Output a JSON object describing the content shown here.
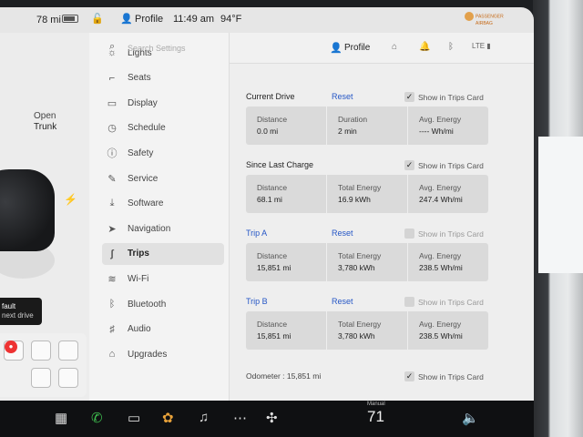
{
  "status": {
    "range": "78 mi",
    "profile": "Profile",
    "time": "11:49 am",
    "temp": "94°F",
    "airbag": [
      "PASSENGER",
      "AIRBAG"
    ]
  },
  "car": {
    "open_label": "Open",
    "trunk_label": "Trunk",
    "fault_title": "fault",
    "fault_sub": "next drive"
  },
  "search": {
    "placeholder": "Search Settings"
  },
  "header": {
    "profile": "Profile"
  },
  "menu": {
    "items": [
      {
        "label": "Lights",
        "icon": "lights-icon"
      },
      {
        "label": "Seats",
        "icon": "seat-icon"
      },
      {
        "label": "Display",
        "icon": "display-icon"
      },
      {
        "label": "Schedule",
        "icon": "schedule-icon"
      },
      {
        "label": "Safety",
        "icon": "safety-icon"
      },
      {
        "label": "Service",
        "icon": "wrench-icon"
      },
      {
        "label": "Software",
        "icon": "download-icon"
      },
      {
        "label": "Navigation",
        "icon": "navigation-icon"
      },
      {
        "label": "Trips",
        "icon": "trips-icon"
      },
      {
        "label": "Wi-Fi",
        "icon": "wifi-icon"
      },
      {
        "label": "Bluetooth",
        "icon": "bluetooth-icon"
      },
      {
        "label": "Audio",
        "icon": "audio-icon"
      },
      {
        "label": "Upgrades",
        "icon": "upgrades-icon"
      }
    ],
    "active": "Trips"
  },
  "trips": {
    "current": {
      "title": "Current Drive",
      "reset": "Reset",
      "show": "Show in Trips Card",
      "checked": true,
      "cells": [
        {
          "label": "Distance",
          "value": "0.0 mi"
        },
        {
          "label": "Duration",
          "value": "2 min"
        },
        {
          "label": "Avg. Energy",
          "value": "---- Wh/mi"
        }
      ]
    },
    "since_charge": {
      "title": "Since Last Charge",
      "show": "Show in Trips Card",
      "checked": true,
      "cells": [
        {
          "label": "Distance",
          "value": "68.1 mi"
        },
        {
          "label": "Total Energy",
          "value": "16.9 kWh"
        },
        {
          "label": "Avg. Energy",
          "value": "247.4 Wh/mi"
        }
      ]
    },
    "trip_a": {
      "title": "Trip A",
      "reset": "Reset",
      "show": "Show in Trips Card",
      "checked": false,
      "cells": [
        {
          "label": "Distance",
          "value": "15,851 mi"
        },
        {
          "label": "Total Energy",
          "value": "3,780 kWh"
        },
        {
          "label": "Avg. Energy",
          "value": "238.5 Wh/mi"
        }
      ]
    },
    "trip_b": {
      "title": "Trip B",
      "reset": "Reset",
      "show": "Show in Trips Card",
      "checked": false,
      "cells": [
        {
          "label": "Distance",
          "value": "15,851 mi"
        },
        {
          "label": "Total Energy",
          "value": "3,780 kWh"
        },
        {
          "label": "Avg. Energy",
          "value": "238.5 Wh/mi"
        }
      ]
    },
    "odometer": "Odometer : 15,851 mi",
    "odometer_show": "Show in Trips Card"
  },
  "dock": {
    "temp_label": "Manual",
    "temp": "71"
  }
}
